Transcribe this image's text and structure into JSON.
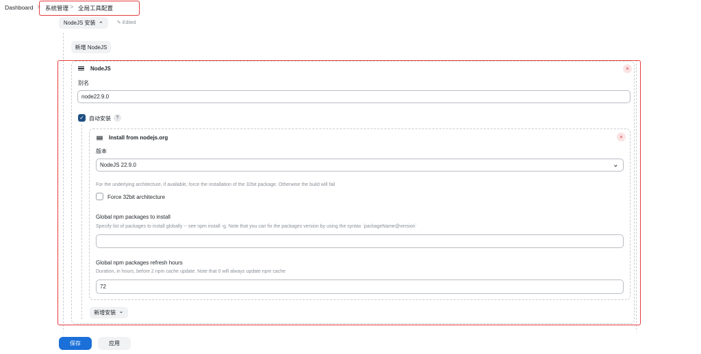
{
  "breadcrumb": {
    "items": [
      "Dashboard",
      "系统管理",
      "全局工具配置"
    ],
    "separator": ">"
  },
  "section": {
    "title": "NodeJS 安装",
    "edited": "Edited"
  },
  "add_nodejs_button": "新增 NodeJS",
  "nodejs_card": {
    "title": "NodeJS",
    "alias_label": "别名",
    "alias_value": "node22.9.0",
    "auto_install_label": "自动安装",
    "auto_install_checked": true,
    "help_icon": "?"
  },
  "installer_card": {
    "title": "Install from nodejs.org",
    "version_label": "版本",
    "version_value": "NodeJS 22.9.0",
    "arch_help": "For the underlying architecture, if available, force the installation of the 32bit package. Otherwise the build will fail",
    "force32_label": "Force 32bit architecture",
    "force32_checked": false,
    "global_pkgs_label": "Global npm packages to install",
    "global_pkgs_help": "Specify list of packages to install globally -- see npm install -g. Note that you can fix the packages version by using the syntax `packageName@version`",
    "global_pkgs_value": "",
    "refresh_label": "Global npm packages refresh hours",
    "refresh_help": "Duration, in hours, before 2 npm cache update. Note that 0 will always update npm cache",
    "refresh_value": "72"
  },
  "add_installer_button": "新增安装",
  "footer": {
    "save": "保存",
    "apply": "应用"
  },
  "icons": {
    "close": "×",
    "chevron_up": "⌃",
    "chevron_down": "⌄",
    "pencil": "✎",
    "check": "✓"
  },
  "colors": {
    "highlight": "#e5393b",
    "primary": "#1a6fd8",
    "checkbox": "#1e4f82"
  }
}
